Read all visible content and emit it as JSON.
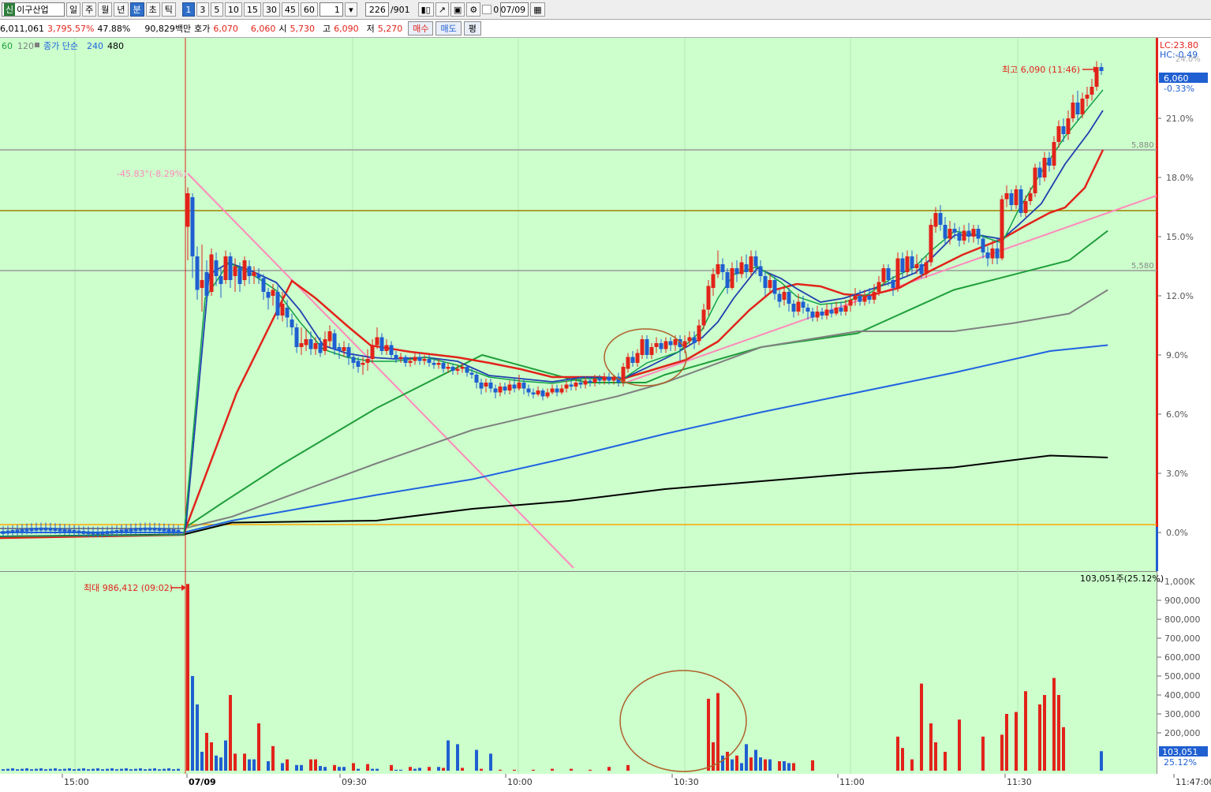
{
  "toolbar": {
    "market_badge": "신",
    "stock_name": "이구산업",
    "periods": [
      "일",
      "주",
      "월",
      "년",
      "분",
      "초",
      "틱"
    ],
    "active_period": "분",
    "intervals": [
      "1",
      "3",
      "5",
      "10",
      "15",
      "30",
      "45",
      "60"
    ],
    "active_interval": "1",
    "unit_value": "1",
    "count_display": "226",
    "count_total": "/901",
    "checkbox_label": "0",
    "date_value": "07/09"
  },
  "info": {
    "volume": "6,011,061",
    "volume_ratio": "3,795.57%",
    "turnover_pct": "47.88%",
    "amount": "90,829백만",
    "quote_label": "호가",
    "ask": "6,070",
    "bid": "6,060",
    "open_label": "시",
    "open": "5,730",
    "high_label": "고",
    "high": "6,090",
    "low_label": "저",
    "low": "5,270",
    "buy_label": "매수",
    "sell_label": "매도",
    "eval_label": "평"
  },
  "legend": {
    "ma60": "60",
    "ma120": "120",
    "ma_type": "종가 단순",
    "ma240": "240",
    "ma480": "480"
  },
  "colors": {
    "background": "#ccffcc",
    "up": "#e2231a",
    "down": "#1f5fd1"
  },
  "annotations": {
    "high_marker": "최고 6,090 (11:46)",
    "drop_label": "-45.83°(-8.29%)",
    "volume_max": "최대 986,412 (09:02)",
    "volume_info": "103,051주(25.12%)",
    "level_high": "5,880",
    "level_low": "5,580",
    "lc": "LC:23.80",
    "hc": "HC:-0.49",
    "top_axis_partial": "24.0%",
    "current_price": "6,060",
    "current_pct": "-0.33%",
    "volume_current": "103,051",
    "volume_current_pct": "25.12%"
  },
  "chart_data": [
    {
      "type": "line",
      "title": "",
      "xlabel": "",
      "ylabel": "",
      "x_tick_labels": [
        "15:00",
        "07/09",
        "09:30",
        "10:00",
        "10:30",
        "11:00",
        "11:30",
        "11:47:00"
      ],
      "y_tick_labels": [
        "21.0%",
        "18.0%",
        "15.0%",
        "12.0%",
        "9.0%",
        "6.0%",
        "3.0%",
        "0.0%"
      ],
      "ylim": [
        -0.5,
        24.0
      ],
      "grid": true,
      "series": [
        {
          "name": "60",
          "color": "#1f9e3a",
          "points": [
            [
              0,
              0.2
            ],
            [
              1,
              0.2
            ],
            [
              1.4,
              1.5
            ],
            [
              2.0,
              3.4
            ],
            [
              3.0,
              6.3
            ],
            [
              4.1,
              9.0
            ],
            [
              5.0,
              7.8
            ],
            [
              5.2,
              7.6
            ],
            [
              5.8,
              7.6
            ],
            [
              6.0,
              8.0
            ],
            [
              7.0,
              9.4
            ],
            [
              8.0,
              10.1
            ],
            [
              9.0,
              12.3
            ],
            [
              10.2,
              13.8
            ],
            [
              10.6,
              15.3
            ]
          ]
        },
        {
          "name": "120",
          "color": "#808080",
          "points": [
            [
              0,
              0.2
            ],
            [
              1,
              0.2
            ],
            [
              1.5,
              0.8
            ],
            [
              3.0,
              3.5
            ],
            [
              4.0,
              5.2
            ],
            [
              5.5,
              6.9
            ],
            [
              6.0,
              7.6
            ],
            [
              7.0,
              9.4
            ],
            [
              8.0,
              10.2
            ],
            [
              9.0,
              10.2
            ],
            [
              9.6,
              10.6
            ],
            [
              10.2,
              11.1
            ],
            [
              10.6,
              12.3
            ]
          ]
        },
        {
          "name": "240",
          "color": "#1f63e0",
          "points": [
            [
              0,
              0.0
            ],
            [
              1,
              0.0
            ],
            [
              1.5,
              0.6
            ],
            [
              3.0,
              1.9
            ],
            [
              4.0,
              2.7
            ],
            [
              5.0,
              3.8
            ],
            [
              6.0,
              5.0
            ],
            [
              7.0,
              6.1
            ],
            [
              8.0,
              7.1
            ],
            [
              9.0,
              8.1
            ],
            [
              10.0,
              9.2
            ],
            [
              10.6,
              9.5
            ]
          ]
        },
        {
          "name": "480",
          "color": "#000000",
          "points": [
            [
              0,
              -0.2
            ],
            [
              1,
              -0.1
            ],
            [
              1.5,
              0.5
            ],
            [
              3.0,
              0.6
            ],
            [
              4.0,
              1.2
            ],
            [
              5.0,
              1.6
            ],
            [
              6.0,
              2.2
            ],
            [
              7.0,
              2.6
            ],
            [
              8.0,
              3.0
            ],
            [
              9.0,
              3.3
            ],
            [
              10.0,
              3.9
            ],
            [
              10.6,
              3.8
            ]
          ]
        }
      ]
    },
    {
      "type": "bar",
      "title": "",
      "ylabel": "",
      "y_tick_labels": [
        "1,000K",
        "900,000",
        "800,000",
        "700,000",
        "600,000",
        "500,000",
        "400,000",
        "300,000",
        "200,000"
      ],
      "ylim": [
        0,
        1000000
      ],
      "series": [
        {
          "name": "",
          "values_up": [
            986412,
            200000,
            150000,
            400000,
            90000,
            90000,
            250000,
            130000,
            60000,
            60000,
            60000,
            30000,
            40000,
            35000,
            30000,
            20000,
            20000,
            15000,
            15000,
            10000,
            5000,
            5000,
            5000,
            10000,
            10000,
            5000,
            20000,
            30000,
            380000,
            410000,
            150000,
            100000,
            80000,
            70000,
            60000,
            50000,
            40000,
            55000,
            180000,
            120000,
            60000,
            460000,
            250000,
            150000,
            100000,
            270000,
            180000,
            190000,
            300000,
            310000,
            420000,
            350000,
            400000,
            490000,
            400000,
            230000
          ]
        },
        {
          "name": "",
          "values_down": [
            500000,
            350000,
            100000,
            80000,
            70000,
            160000,
            60000,
            60000,
            50000,
            40000,
            30000,
            30000,
            25000,
            20000,
            20000,
            20000,
            10000,
            10000,
            10000,
            5000,
            5000,
            10000,
            15000,
            20000,
            160000,
            140000,
            110000,
            90000,
            80000,
            60000,
            40000,
            140000,
            110000,
            70000,
            60000,
            50000,
            40000,
            103051
          ]
        }
      ]
    }
  ]
}
